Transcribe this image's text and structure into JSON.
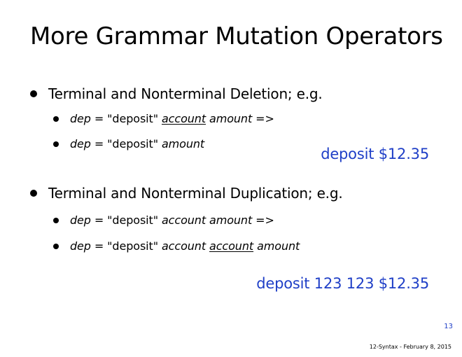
{
  "slide": {
    "title": "More Grammar Mutation Operators",
    "sections": [
      {
        "heading": "Terminal and Nonterminal Deletion; e.g.",
        "items": [
          {
            "lhs": "dep",
            "eq": " = ",
            "terminal": "\"deposit\"",
            "space1": " ",
            "highlight": "account",
            "space2": " ",
            "rest": "amount",
            "arrow": " =>"
          },
          {
            "lhs": "dep",
            "eq": " = ",
            "terminal": "\"deposit\"",
            "space1": " ",
            "rest": "amount"
          }
        ],
        "result": "deposit $12.35"
      },
      {
        "heading": "Terminal and Nonterminal Duplication; e.g.",
        "items": [
          {
            "lhs": "dep",
            "eq": " = ",
            "terminal": "\"deposit\"",
            "space1": " ",
            "word1": "account",
            "space2": " ",
            "rest": "amount",
            "arrow": " =>"
          },
          {
            "lhs": "dep",
            "eq": " = ",
            "terminal": "\"deposit\"",
            "space1": " ",
            "word1": "account",
            "space2": " ",
            "highlight": "account",
            "space3": " ",
            "rest": "amount"
          }
        ],
        "result": "deposit 123 123 $12.35"
      }
    ],
    "page_number": "13",
    "footer": "12-Syntax - February 8, 2015",
    "colors": {
      "text": "#000000",
      "accent": "#1f3fc7",
      "background": "#ffffff"
    }
  }
}
